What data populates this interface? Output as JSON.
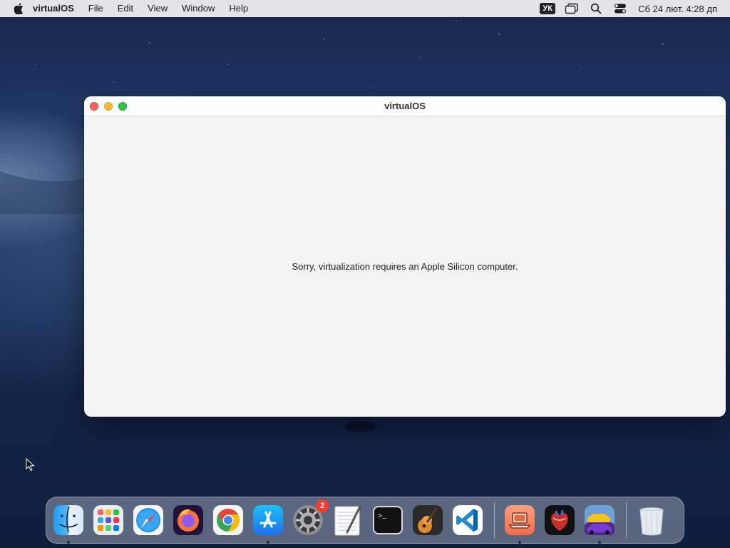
{
  "menubar": {
    "app_name": "virtualOS",
    "items": [
      "File",
      "Edit",
      "View",
      "Window",
      "Help"
    ],
    "input_source": "УК",
    "clock": "Сб 24 лют.  4:28 дп"
  },
  "window": {
    "title": "virtualOS",
    "message": "Sorry, virtualization requires an Apple Silicon computer."
  },
  "dock": {
    "apps": [
      {
        "name": "Finder",
        "icon": "finder-icon",
        "running": true
      },
      {
        "name": "Launchpad",
        "icon": "launchpad-icon",
        "running": false
      },
      {
        "name": "Safari",
        "icon": "safari-icon",
        "running": false
      },
      {
        "name": "Firefox",
        "icon": "firefox-icon",
        "running": false
      },
      {
        "name": "Google Chrome",
        "icon": "chrome-icon",
        "running": false
      },
      {
        "name": "App Store",
        "icon": "app-store-icon",
        "running": true
      },
      {
        "name": "System Preferences",
        "icon": "system-preferences-icon",
        "running": false,
        "badge": "2"
      },
      {
        "name": "TextEdit",
        "icon": "textedit-icon",
        "running": false
      },
      {
        "name": "Terminal",
        "icon": "terminal-icon",
        "running": false
      },
      {
        "name": "GarageBand",
        "icon": "garageband-icon",
        "running": false
      },
      {
        "name": "Visual Studio Code",
        "icon": "vscode-icon",
        "running": false
      }
    ],
    "recent": [
      {
        "name": "virtualOS",
        "icon": "virtualos-icon",
        "running": true
      },
      {
        "name": "Anatomy",
        "icon": "heart-anatomy-icon",
        "running": false
      },
      {
        "name": "Racing",
        "icon": "racing-car-icon",
        "running": true
      }
    ],
    "trash": {
      "name": "Trash",
      "icon": "trash-icon"
    }
  },
  "colors": {
    "close": "#fe5f57",
    "minimize": "#febc2e",
    "maximize": "#28c840",
    "badge": "#ff3b30"
  }
}
